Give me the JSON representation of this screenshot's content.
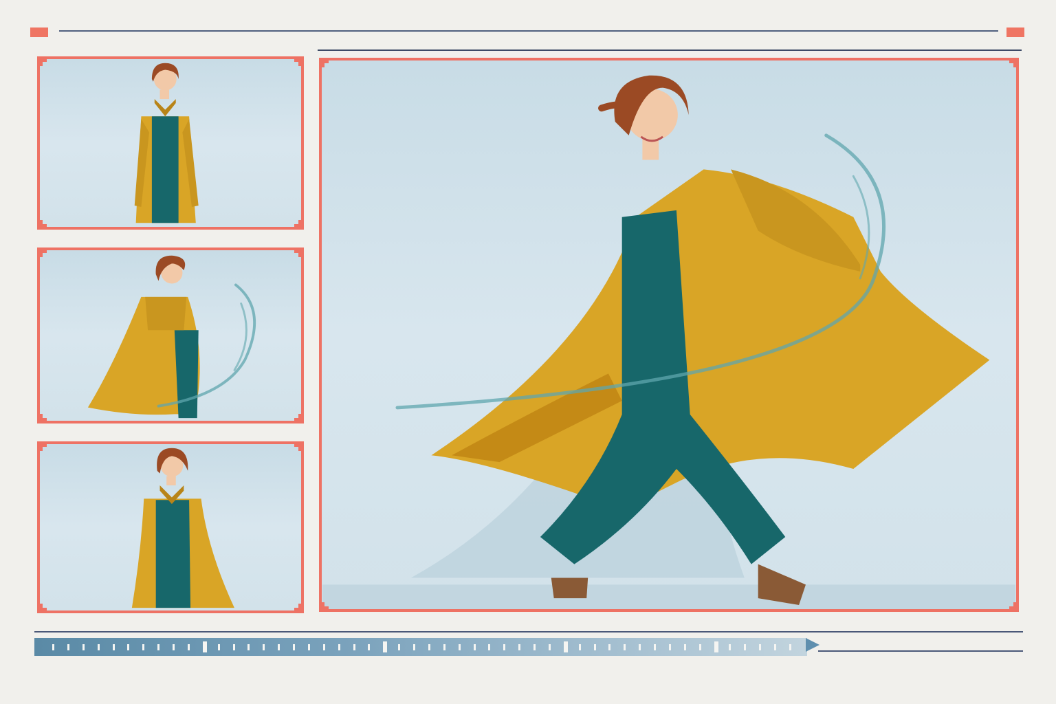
{
  "colors": {
    "accent": "#ee7264",
    "rule": "#4f5f7e",
    "sky": "#cfe0e8",
    "coat": "#d9a526",
    "jumpsuit": "#17676a",
    "hair": "#9b4a24",
    "scrubber": "#6f9ab6"
  },
  "frames": {
    "thumbnails": [
      {
        "name": "thumb-standing-front",
        "pose": "standing"
      },
      {
        "name": "thumb-turning",
        "pose": "turning"
      },
      {
        "name": "thumb-standing-smile",
        "pose": "standing"
      }
    ],
    "main": {
      "name": "main-preview",
      "pose": "walking"
    }
  },
  "timeline": {
    "icon": "play-arrow-icon",
    "progress": 0.0,
    "tick_count": 50
  }
}
